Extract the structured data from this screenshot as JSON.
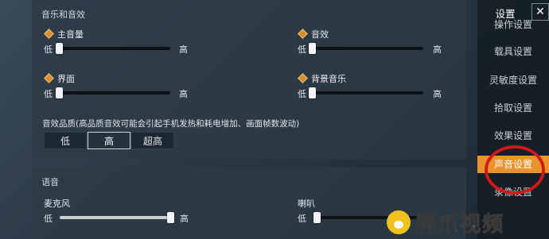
{
  "audio": {
    "section_title": "音乐和音效",
    "sliders": [
      {
        "label": "主音量",
        "low": "低",
        "high": "高",
        "value": 0.0
      },
      {
        "label": "音效",
        "low": "低",
        "high": "高",
        "value": 0.0
      },
      {
        "label": "界面",
        "low": "低",
        "high": "高",
        "value": 0.0
      },
      {
        "label": "背景音乐",
        "low": "低",
        "high": "高",
        "value": 0.0
      }
    ],
    "quality_label": "音效品质(高品质音效可能会引起手机发热和耗电增加、画面帧数波动)",
    "quality_options": [
      "低",
      "高",
      "超高"
    ],
    "quality_selected": "高"
  },
  "voice": {
    "section_title": "语音",
    "sliders": [
      {
        "label": "麦克风",
        "low": "低",
        "high": "高",
        "value": 1.0
      },
      {
        "label": "喇叭",
        "low": "低",
        "high": "",
        "value": 0.0
      }
    ]
  },
  "sidebar": {
    "title": "设置",
    "close_icon": "close-icon",
    "items": [
      "操作设置",
      "载具设置",
      "灵敏度设置",
      "拾取设置",
      "效果设置",
      "声音设置",
      "录像设置"
    ],
    "active": "声音设置"
  },
  "watermark": {
    "text": "胖爪视频",
    "icon": "paw-icon"
  },
  "colors": {
    "accent": "#e8932c",
    "highlight_ring": "#d41818"
  }
}
